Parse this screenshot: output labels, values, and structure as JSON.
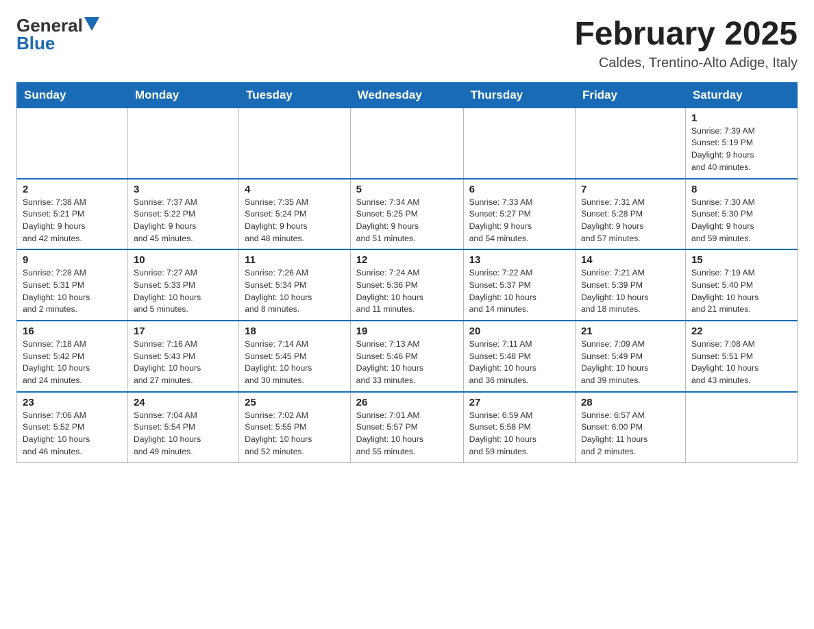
{
  "header": {
    "logo_general": "General",
    "logo_blue": "Blue",
    "month_title": "February 2025",
    "location": "Caldes, Trentino-Alto Adige, Italy"
  },
  "weekdays": [
    "Sunday",
    "Monday",
    "Tuesday",
    "Wednesday",
    "Thursday",
    "Friday",
    "Saturday"
  ],
  "weeks": [
    [
      {
        "day": "",
        "info": ""
      },
      {
        "day": "",
        "info": ""
      },
      {
        "day": "",
        "info": ""
      },
      {
        "day": "",
        "info": ""
      },
      {
        "day": "",
        "info": ""
      },
      {
        "day": "",
        "info": ""
      },
      {
        "day": "1",
        "info": "Sunrise: 7:39 AM\nSunset: 5:19 PM\nDaylight: 9 hours\nand 40 minutes."
      }
    ],
    [
      {
        "day": "2",
        "info": "Sunrise: 7:38 AM\nSunset: 5:21 PM\nDaylight: 9 hours\nand 42 minutes."
      },
      {
        "day": "3",
        "info": "Sunrise: 7:37 AM\nSunset: 5:22 PM\nDaylight: 9 hours\nand 45 minutes."
      },
      {
        "day": "4",
        "info": "Sunrise: 7:35 AM\nSunset: 5:24 PM\nDaylight: 9 hours\nand 48 minutes."
      },
      {
        "day": "5",
        "info": "Sunrise: 7:34 AM\nSunset: 5:25 PM\nDaylight: 9 hours\nand 51 minutes."
      },
      {
        "day": "6",
        "info": "Sunrise: 7:33 AM\nSunset: 5:27 PM\nDaylight: 9 hours\nand 54 minutes."
      },
      {
        "day": "7",
        "info": "Sunrise: 7:31 AM\nSunset: 5:28 PM\nDaylight: 9 hours\nand 57 minutes."
      },
      {
        "day": "8",
        "info": "Sunrise: 7:30 AM\nSunset: 5:30 PM\nDaylight: 9 hours\nand 59 minutes."
      }
    ],
    [
      {
        "day": "9",
        "info": "Sunrise: 7:28 AM\nSunset: 5:31 PM\nDaylight: 10 hours\nand 2 minutes."
      },
      {
        "day": "10",
        "info": "Sunrise: 7:27 AM\nSunset: 5:33 PM\nDaylight: 10 hours\nand 5 minutes."
      },
      {
        "day": "11",
        "info": "Sunrise: 7:26 AM\nSunset: 5:34 PM\nDaylight: 10 hours\nand 8 minutes."
      },
      {
        "day": "12",
        "info": "Sunrise: 7:24 AM\nSunset: 5:36 PM\nDaylight: 10 hours\nand 11 minutes."
      },
      {
        "day": "13",
        "info": "Sunrise: 7:22 AM\nSunset: 5:37 PM\nDaylight: 10 hours\nand 14 minutes."
      },
      {
        "day": "14",
        "info": "Sunrise: 7:21 AM\nSunset: 5:39 PM\nDaylight: 10 hours\nand 18 minutes."
      },
      {
        "day": "15",
        "info": "Sunrise: 7:19 AM\nSunset: 5:40 PM\nDaylight: 10 hours\nand 21 minutes."
      }
    ],
    [
      {
        "day": "16",
        "info": "Sunrise: 7:18 AM\nSunset: 5:42 PM\nDaylight: 10 hours\nand 24 minutes."
      },
      {
        "day": "17",
        "info": "Sunrise: 7:16 AM\nSunset: 5:43 PM\nDaylight: 10 hours\nand 27 minutes."
      },
      {
        "day": "18",
        "info": "Sunrise: 7:14 AM\nSunset: 5:45 PM\nDaylight: 10 hours\nand 30 minutes."
      },
      {
        "day": "19",
        "info": "Sunrise: 7:13 AM\nSunset: 5:46 PM\nDaylight: 10 hours\nand 33 minutes."
      },
      {
        "day": "20",
        "info": "Sunrise: 7:11 AM\nSunset: 5:48 PM\nDaylight: 10 hours\nand 36 minutes."
      },
      {
        "day": "21",
        "info": "Sunrise: 7:09 AM\nSunset: 5:49 PM\nDaylight: 10 hours\nand 39 minutes."
      },
      {
        "day": "22",
        "info": "Sunrise: 7:08 AM\nSunset: 5:51 PM\nDaylight: 10 hours\nand 43 minutes."
      }
    ],
    [
      {
        "day": "23",
        "info": "Sunrise: 7:06 AM\nSunset: 5:52 PM\nDaylight: 10 hours\nand 46 minutes."
      },
      {
        "day": "24",
        "info": "Sunrise: 7:04 AM\nSunset: 5:54 PM\nDaylight: 10 hours\nand 49 minutes."
      },
      {
        "day": "25",
        "info": "Sunrise: 7:02 AM\nSunset: 5:55 PM\nDaylight: 10 hours\nand 52 minutes."
      },
      {
        "day": "26",
        "info": "Sunrise: 7:01 AM\nSunset: 5:57 PM\nDaylight: 10 hours\nand 55 minutes."
      },
      {
        "day": "27",
        "info": "Sunrise: 6:59 AM\nSunset: 5:58 PM\nDaylight: 10 hours\nand 59 minutes."
      },
      {
        "day": "28",
        "info": "Sunrise: 6:57 AM\nSunset: 6:00 PM\nDaylight: 11 hours\nand 2 minutes."
      },
      {
        "day": "",
        "info": ""
      }
    ]
  ]
}
